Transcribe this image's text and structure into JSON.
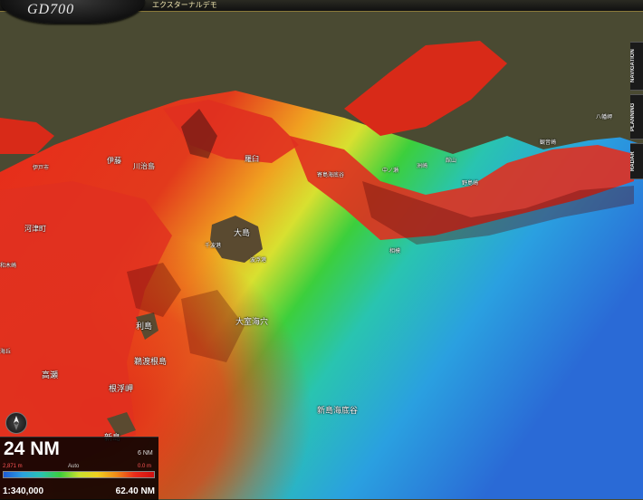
{
  "app": {
    "logo": "GD700",
    "title": "エクスターナルデモ"
  },
  "side_tabs": [
    "NAVIGATION",
    "PLANNING",
    "RADAR"
  ],
  "places": [
    {
      "text": "羅臼",
      "cls": "place"
    },
    {
      "text": "伊藤",
      "cls": "place"
    },
    {
      "text": "川治島",
      "cls": "place"
    },
    {
      "text": "伊戸市",
      "cls": "place small"
    },
    {
      "text": "河津町",
      "cls": "place"
    },
    {
      "text": "和木崎",
      "cls": "place small"
    },
    {
      "text": "海丘",
      "cls": "place small"
    },
    {
      "text": "大島",
      "cls": "place big"
    },
    {
      "text": "千波港",
      "cls": "place small"
    },
    {
      "text": "波浮港",
      "cls": "place small"
    },
    {
      "text": "利島",
      "cls": "place big"
    },
    {
      "text": "大室海穴",
      "cls": "place big"
    },
    {
      "text": "鵜渡根島",
      "cls": "place big"
    },
    {
      "text": "高瀬",
      "cls": "place big"
    },
    {
      "text": "根浮岬",
      "cls": "place big"
    },
    {
      "text": "新島",
      "cls": "place big"
    },
    {
      "text": "新島海底谷",
      "cls": "place big"
    },
    {
      "text": "寄島海底谷",
      "cls": "place small"
    },
    {
      "text": "中ノ瀬",
      "cls": "place small"
    },
    {
      "text": "相模",
      "cls": "place small"
    },
    {
      "text": "野島崎",
      "cls": "place small"
    },
    {
      "text": "洲崎",
      "cls": "place small"
    },
    {
      "text": "館山",
      "cls": "place small"
    },
    {
      "text": "観音崎",
      "cls": "place small"
    },
    {
      "text": "八幡岬",
      "cls": "place small"
    }
  ],
  "panel": {
    "range": "24 NM",
    "scale_nm": "6 NM",
    "depth_max": "2,871 m",
    "depth_mode": "Auto",
    "depth_min": "0.0 m",
    "scale_ratio": "1:340,000",
    "range_total": "62.40 NM"
  },
  "colors": {
    "accent": "#8a7a3a",
    "land": "#4a4a32",
    "shallow": "#d01010",
    "deep": "#1e5bd6"
  }
}
